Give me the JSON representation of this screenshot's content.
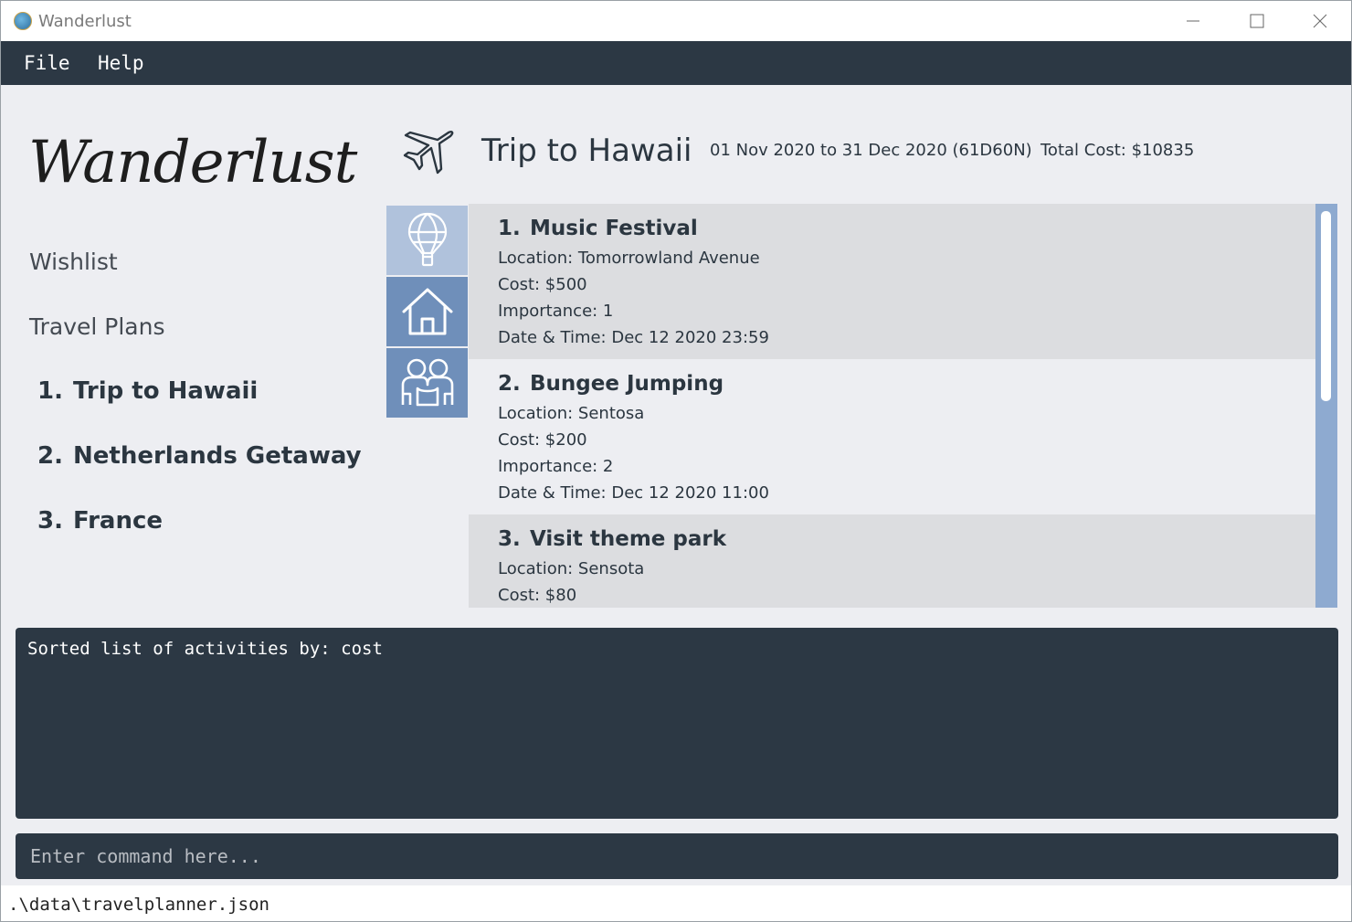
{
  "window": {
    "title": "Wanderlust",
    "icons": {
      "app": "app-globe-icon",
      "minimize": "minimize-icon",
      "maximize": "maximize-icon",
      "close": "close-icon"
    }
  },
  "menu": {
    "file": "File",
    "help": "Help"
  },
  "sidebar": {
    "logo": "Wanderlust",
    "wishlist": "Wishlist",
    "travel_plans": "Travel Plans",
    "plans": [
      {
        "num": "1.",
        "name": "Trip to Hawaii"
      },
      {
        "num": "2.",
        "name": "Netherlands Getaway"
      },
      {
        "num": "3.",
        "name": "France"
      }
    ]
  },
  "header": {
    "icon": "airplane-icon",
    "title": "Trip to Hawaii",
    "dates": "01 Nov 2020 to 31 Dec 2020 (61D60N)",
    "total_cost": "Total Cost: $10835"
  },
  "tabs": [
    {
      "name": "activities",
      "icon": "hot-air-balloon-icon",
      "selected": true
    },
    {
      "name": "accommodations",
      "icon": "house-icon",
      "selected": false
    },
    {
      "name": "friends",
      "icon": "friends-icon",
      "selected": false
    }
  ],
  "activities": [
    {
      "num": "1.",
      "name": "Music Festival",
      "location": "Location: Tomorrowland Avenue",
      "cost": "Cost: $500",
      "importance": "Importance: 1",
      "datetime": "Date & Time: Dec 12 2020 23:59"
    },
    {
      "num": "2.",
      "name": "Bungee Jumping",
      "location": "Location: Sentosa",
      "cost": "Cost: $200",
      "importance": "Importance: 2",
      "datetime": "Date & Time: Dec 12 2020 11:00"
    },
    {
      "num": "3.",
      "name": "Visit theme park",
      "location": "Location: Sensota",
      "cost": "Cost: $80"
    }
  ],
  "result": {
    "text": "Sorted list of activities by: cost"
  },
  "command": {
    "placeholder": "Enter command here...",
    "value": ""
  },
  "status": {
    "path": ".\\data\\travelplanner.json"
  },
  "colors": {
    "dark_panel": "#2c3844",
    "tab_selected": "#b0c2dc",
    "tab_default": "#6f8fba",
    "scrollbar": "#8eaad0"
  }
}
